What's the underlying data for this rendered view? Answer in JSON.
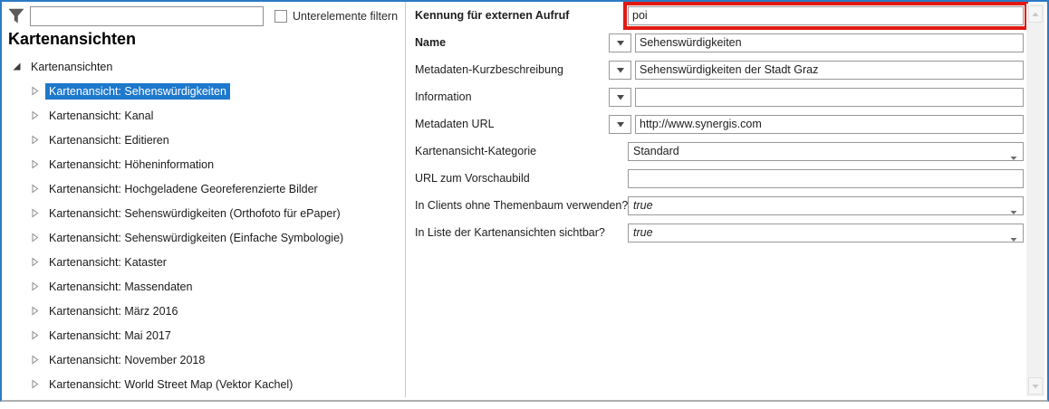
{
  "filter_bar": {
    "search_value": "",
    "checkbox_label": "Unterelemente filtern"
  },
  "left_panel": {
    "title": "Kartenansichten",
    "tree": {
      "root_label": "Kartenansichten",
      "items": [
        {
          "label": "Kartenansicht: Sehenswürdigkeiten",
          "selected": true
        },
        {
          "label": "Kartenansicht: Kanal"
        },
        {
          "label": "Kartenansicht: Editieren"
        },
        {
          "label": "Kartenansicht: Höheninformation"
        },
        {
          "label": "Kartenansicht: Hochgeladene Georeferenzierte Bilder"
        },
        {
          "label": "Kartenansicht: Sehenswürdigkeiten (Orthofoto für ePaper)"
        },
        {
          "label": "Kartenansicht: Sehenswürdigkeiten (Einfache Symbologie)"
        },
        {
          "label": "Kartenansicht: Kataster"
        },
        {
          "label": "Kartenansicht: Massendaten"
        },
        {
          "label": "Kartenansicht: März 2016"
        },
        {
          "label": "Kartenansicht: Mai 2017"
        },
        {
          "label": "Kartenansicht: November 2018"
        },
        {
          "label": "Kartenansicht: World Street Map (Vektor Kachel)"
        }
      ]
    }
  },
  "form": {
    "rows": [
      {
        "label": "Kennung für externen Aufruf",
        "value": "poi",
        "type": "text",
        "bold": true,
        "annotated": true
      },
      {
        "label": "Name",
        "value": "Sehenswürdigkeiten",
        "type": "text",
        "bold": true,
        "lang_button": true
      },
      {
        "label": "Metadaten-Kurzbeschreibung",
        "value": "Sehenswürdigkeiten der Stadt Graz",
        "type": "text",
        "lang_button": true
      },
      {
        "label": "Information",
        "value": "",
        "type": "text",
        "lang_button": true
      },
      {
        "label": "Metadaten URL",
        "value": "http://www.synergis.com",
        "type": "text",
        "lang_button": true
      },
      {
        "label": "Kartenansicht-Kategorie",
        "value": "Standard",
        "type": "select"
      },
      {
        "label": "URL zum Vorschaubild",
        "value": "",
        "type": "text"
      },
      {
        "label": "In Clients ohne Themenbaum verwenden?",
        "value": "true",
        "type": "select",
        "italic": true
      },
      {
        "label": "In Liste der Kartenansichten sichtbar?",
        "value": "true",
        "type": "select",
        "italic": true
      }
    ]
  },
  "colors": {
    "window_border": "#2b7ac6",
    "selection_blue": "#1e78cc",
    "annotation_red": "#e11a12",
    "scrollbar_track": "#f1f1f1"
  }
}
